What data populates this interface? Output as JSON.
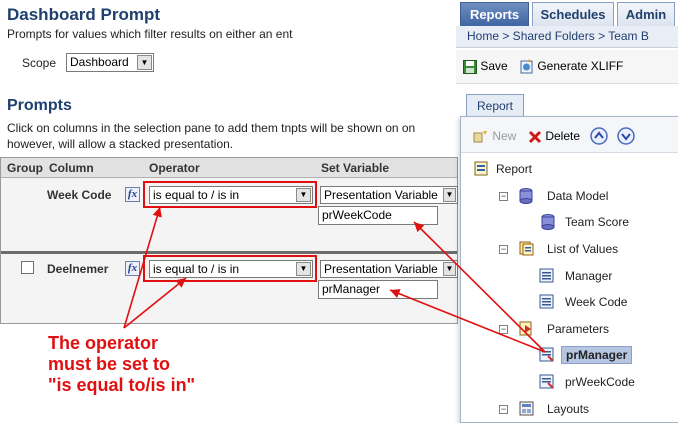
{
  "dashboard_prompt": {
    "title": "Dashboard Prompt",
    "description": "Prompts for values which filter results on either an ent",
    "scope_label": "Scope",
    "scope_value": "Dashboard"
  },
  "prompts": {
    "title": "Prompts",
    "description_line1": "Click on columns in the selection pane to add them tnpts will be shown on on",
    "description_line2": "however, will allow a stacked presentation.",
    "columns": {
      "group": "Group",
      "column": "Column",
      "operator": "Operator",
      "set_variable": "Set Variable"
    },
    "rows": [
      {
        "column": "Week Code",
        "operator": "is equal to / is in",
        "variable_type": "Presentation Variable",
        "variable_name": "prWeekCode"
      },
      {
        "column": "Deelnemer",
        "operator": "is equal to / is in",
        "variable_type": "Presentation Variable",
        "variable_name": "prManager"
      }
    ]
  },
  "annotation": {
    "lines": [
      "The operator",
      "must be set to",
      "\"is equal to/is in\""
    ],
    "color": "#e01010"
  },
  "top_tabs": [
    "Reports",
    "Schedules",
    "Admin"
  ],
  "breadcrumb": "Home > Shared Folders > Team B",
  "toolbar": {
    "save": "Save",
    "generate_xliff": "Generate XLIFF"
  },
  "report_tab": "Report",
  "tree_toolbar": {
    "new": "New",
    "delete": "Delete"
  },
  "tree": {
    "root": "Report",
    "data_model": "Data Model",
    "team_score": "Team Score",
    "list_of_values": "List of Values",
    "manager": "Manager",
    "week_code": "Week Code",
    "parameters": "Parameters",
    "pr_manager": "prManager",
    "pr_week_code": "prWeekCode",
    "layouts": "Layouts"
  },
  "colors": {
    "heading": "#1f3f6e",
    "accent_tab": "#3f65a3",
    "highlight_red": "#e01010"
  }
}
